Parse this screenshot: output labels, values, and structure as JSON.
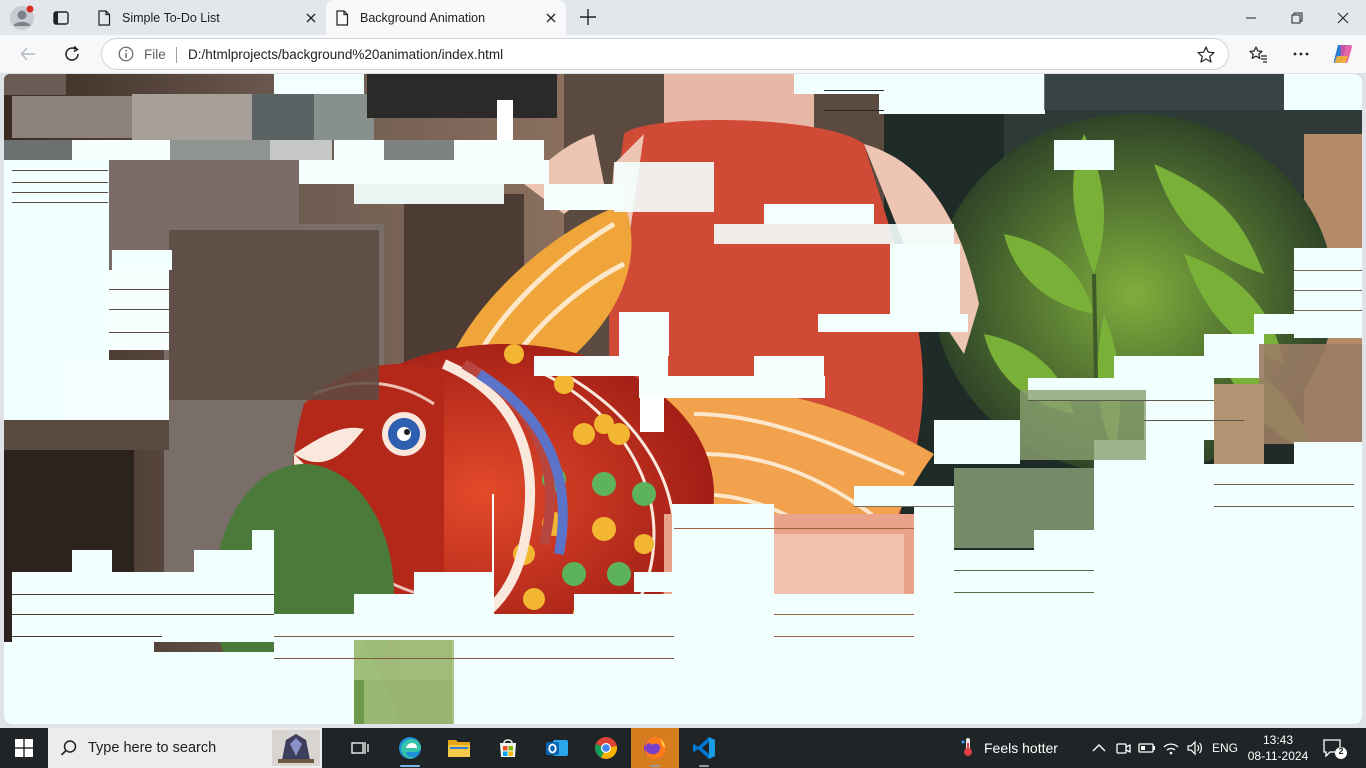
{
  "browser": {
    "tabs": [
      {
        "title": "Simple To-Do List",
        "active": false
      },
      {
        "title": "Background Animation",
        "active": true
      }
    ],
    "address": {
      "scheme_label": "File",
      "url": "D:/htmlprojects/background%20animation/index.html"
    },
    "icons": {
      "profile": "profile-icon",
      "tab_actions": "tab-actions-icon",
      "new_tab": "plus-icon",
      "minimize": "minimize-icon",
      "restore": "restore-icon",
      "close": "close-icon",
      "back": "back-arrow-icon",
      "refresh": "refresh-icon",
      "info": "info-icon",
      "favorite": "star-icon",
      "favorites_list": "favorites-icon",
      "menu": "more-icon",
      "copilot": "copilot-icon"
    }
  },
  "page": {
    "description_colors": {
      "background": "#f1fffe"
    }
  },
  "taskbar": {
    "search_placeholder": "Type here to search",
    "apps": [
      "task-view",
      "edge",
      "file-explorer",
      "microsoft-store",
      "outlook",
      "chrome",
      "firefox",
      "vs-code"
    ],
    "weather_text": "Feels hotter",
    "language": "ENG",
    "time": "13:43",
    "date": "08-11-2024",
    "notification_count": "2"
  }
}
